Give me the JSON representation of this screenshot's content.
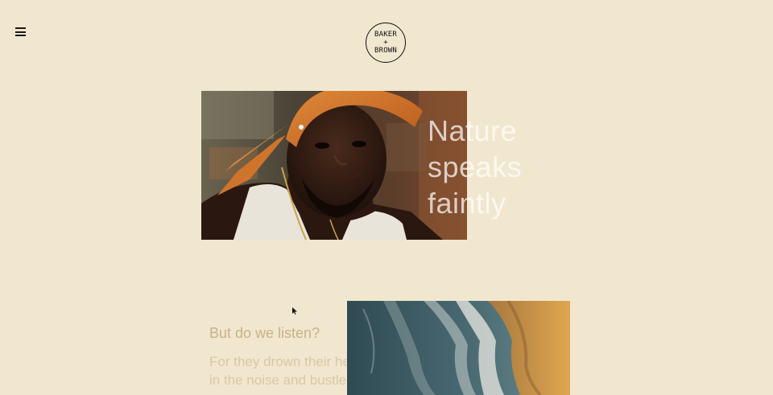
{
  "header": {
    "menu_icon": "hamburger-menu-icon",
    "logo_line1": "BAKER",
    "logo_line2": "+",
    "logo_line3": "BROWN"
  },
  "hero": {
    "headline_line1": "Nature",
    "headline_line2": "speaks",
    "headline_line3": "faintly",
    "photo_subject": "portrait of man with orange bandana"
  },
  "section2": {
    "heading": "But do we listen?",
    "body_line1": "For they drown their hearts",
    "body_line2": "in the noise and bustle of",
    "photo_subject": "aerial view of waves on sandy beach"
  },
  "colors": {
    "background": "#f1e7cf",
    "heading_tan": "#c9b285",
    "body_tan": "#d8c8a4"
  }
}
